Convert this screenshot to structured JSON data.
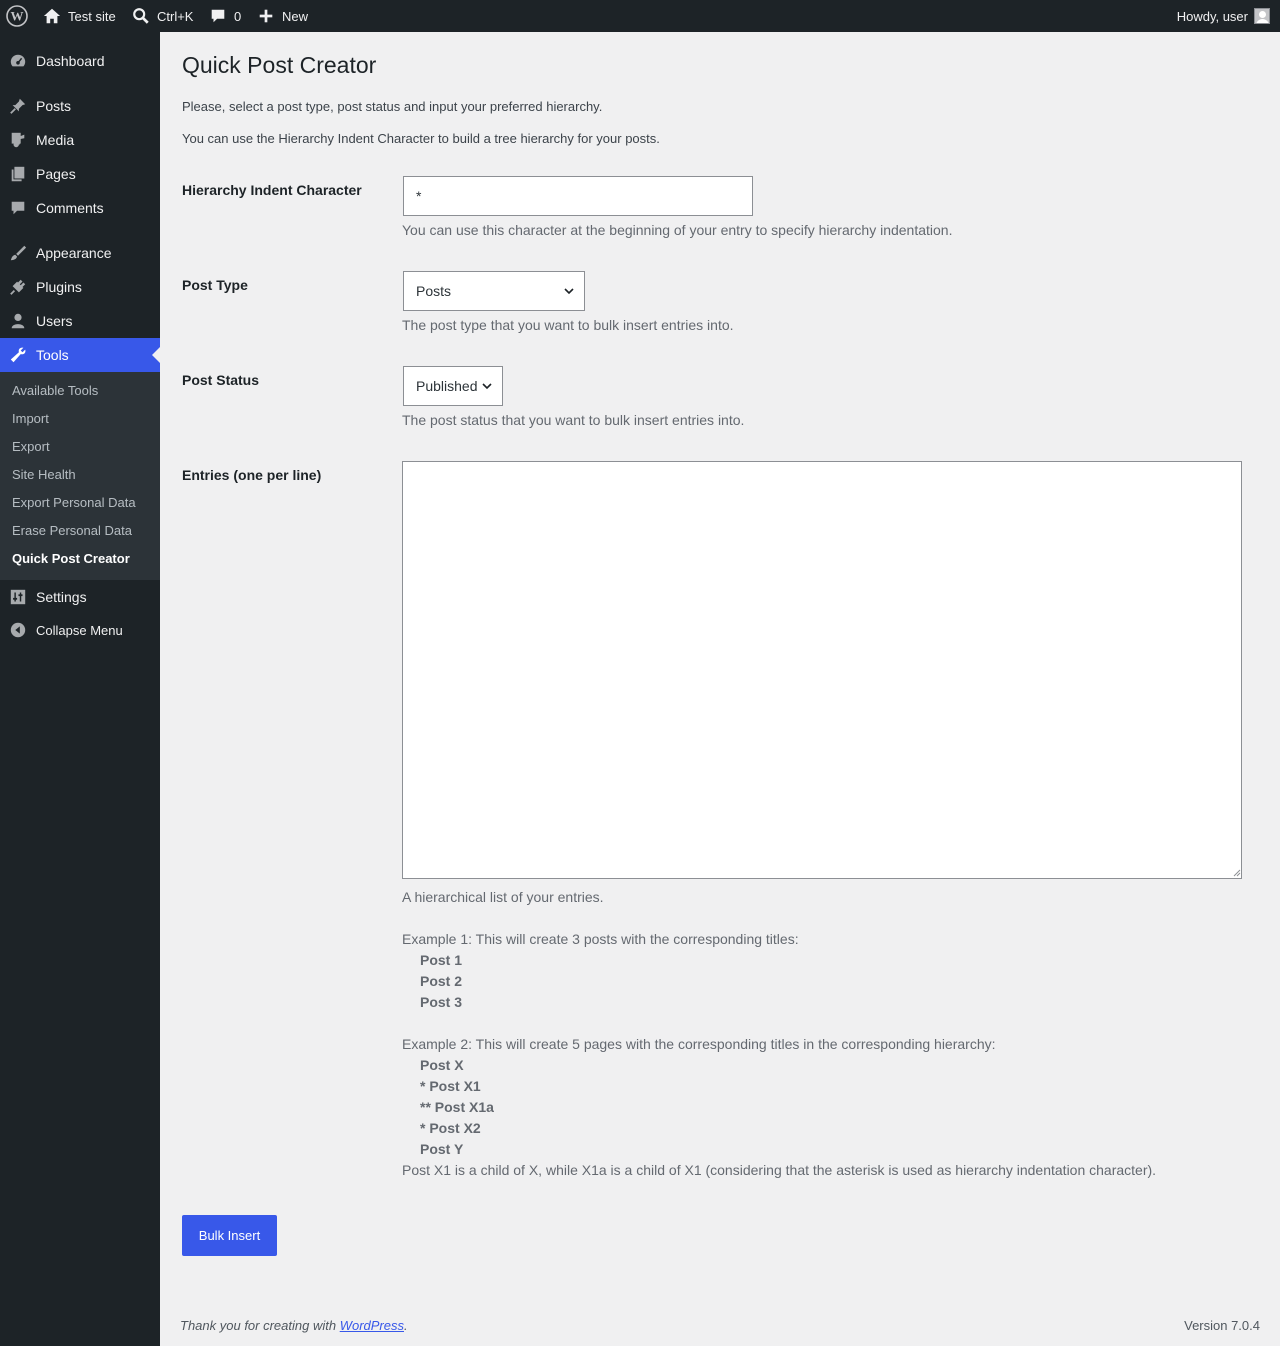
{
  "adminbar": {
    "site_name": "Test site",
    "search_shortcut": "Ctrl+K",
    "comments_count": "0",
    "new_label": "New",
    "howdy": "Howdy, user"
  },
  "sidebar": {
    "items": [
      {
        "label": "Dashboard",
        "icon": "dashboard-icon"
      },
      {
        "label": "Posts",
        "icon": "pin-icon"
      },
      {
        "label": "Media",
        "icon": "media-icon"
      },
      {
        "label": "Pages",
        "icon": "pages-icon"
      },
      {
        "label": "Comments",
        "icon": "comment-icon"
      },
      {
        "label": "Appearance",
        "icon": "brush-icon"
      },
      {
        "label": "Plugins",
        "icon": "plug-icon"
      },
      {
        "label": "Users",
        "icon": "user-icon"
      },
      {
        "label": "Tools",
        "icon": "wrench-icon"
      },
      {
        "label": "Settings",
        "icon": "sliders-icon"
      },
      {
        "label": "Collapse Menu",
        "icon": "collapse-icon"
      }
    ],
    "submenu": [
      "Available Tools",
      "Import",
      "Export",
      "Site Health",
      "Export Personal Data",
      "Erase Personal Data",
      "Quick Post Creator"
    ]
  },
  "page": {
    "title": "Quick Post Creator",
    "intro1": "Please, select a post type, post status and input your preferred hierarchy.",
    "intro2": "You can use the Hierarchy Indent Character to build a tree hierarchy for your posts."
  },
  "form": {
    "indent_label": "Hierarchy Indent Character",
    "indent_value": "*",
    "indent_desc": "You can use this character at the beginning of your entry to specify hierarchy indentation.",
    "post_type_label": "Post Type",
    "post_type_value": "Posts",
    "post_type_desc": "The post type that you want to bulk insert entries into.",
    "post_status_label": "Post Status",
    "post_status_value": "Published",
    "post_status_desc": "The post status that you want to bulk insert entries into.",
    "entries_label": "Entries (one per line)",
    "entries_value": "",
    "entries_desc": "A hierarchical list of your entries.",
    "example1_intro": "Example 1: This will create 3 posts with the corresponding titles:",
    "example1_lines": [
      "Post 1",
      "Post 2",
      "Post 3"
    ],
    "example2_intro": "Example 2: This will create 5 pages with the corresponding titles in the corresponding hierarchy:",
    "example2_lines": [
      "Post X",
      "* Post X1",
      "** Post X1a",
      "* Post X2",
      "Post Y"
    ],
    "example2_note": "Post X1 is a child of X, while X1a is a child of X1 (considering that the asterisk is used as hierarchy indentation character).",
    "submit_label": "Bulk Insert"
  },
  "footer": {
    "thanks_prefix": "Thank you for creating with ",
    "thanks_link": "WordPress",
    "thanks_suffix": ".",
    "version": "Version 7.0.4"
  },
  "colors": {
    "accent": "#3858e9",
    "sidebar_bg": "#1d2327",
    "submenu_bg": "#2c3338",
    "page_bg": "#f0f0f1"
  }
}
